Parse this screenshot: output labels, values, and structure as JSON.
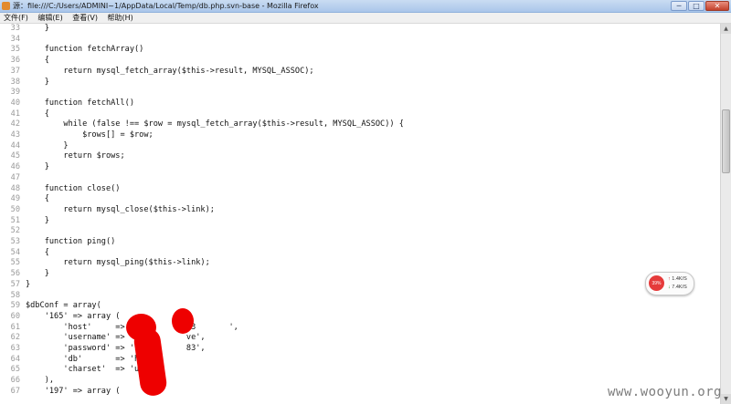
{
  "window": {
    "title": "源：file:///C:/Users/ADMINI~1/AppData/Local/Temp/db.php.svn-base - Mozilla Firefox",
    "buttons": {
      "minimize": "─",
      "maximize": "□",
      "close": "✕"
    }
  },
  "menu": {
    "items": [
      "文件(F)",
      "编辑(E)",
      "查看(V)",
      "帮助(H)"
    ]
  },
  "source": {
    "lines": [
      {
        "num": "33",
        "code": "    }"
      },
      {
        "num": "34",
        "code": ""
      },
      {
        "num": "35",
        "code": "    function fetchArray()"
      },
      {
        "num": "36",
        "code": "    {"
      },
      {
        "num": "37",
        "code": "        return mysql_fetch_array($this->result, MYSQL_ASSOC);"
      },
      {
        "num": "38",
        "code": "    }"
      },
      {
        "num": "39",
        "code": ""
      },
      {
        "num": "40",
        "code": "    function fetchAll()"
      },
      {
        "num": "41",
        "code": "    {"
      },
      {
        "num": "42",
        "code": "        while (false !== $row = mysql_fetch_array($this->result, MYSQL_ASSOC)) {"
      },
      {
        "num": "43",
        "code": "            $rows[] = $row;"
      },
      {
        "num": "44",
        "code": "        }"
      },
      {
        "num": "45",
        "code": "        return $rows;"
      },
      {
        "num": "46",
        "code": "    }"
      },
      {
        "num": "47",
        "code": ""
      },
      {
        "num": "48",
        "code": "    function close()"
      },
      {
        "num": "49",
        "code": "    {"
      },
      {
        "num": "50",
        "code": "        return mysql_close($this->link);"
      },
      {
        "num": "51",
        "code": "    }"
      },
      {
        "num": "52",
        "code": ""
      },
      {
        "num": "53",
        "code": "    function ping()"
      },
      {
        "num": "54",
        "code": "    {"
      },
      {
        "num": "55",
        "code": "        return mysql_ping($this->link);"
      },
      {
        "num": "56",
        "code": "    }"
      },
      {
        "num": "57",
        "code": "}"
      },
      {
        "num": "58",
        "code": ""
      },
      {
        "num": "59",
        "code": "$dbConf = array("
      },
      {
        "num": "60",
        "code": "    '165' => array ("
      },
      {
        "num": "61",
        "code": "        'host'     => '1         203       ',"
      },
      {
        "num": "62",
        "code": "        'username' => 'hj         ve',"
      },
      {
        "num": "63",
        "code": "        'password' => 'sl         83',"
      },
      {
        "num": "64",
        "code": "        'db'       => 'hj"
      },
      {
        "num": "65",
        "code": "        'charset'  => 'utf"
      },
      {
        "num": "66",
        "code": "    ),"
      },
      {
        "num": "67",
        "code": "    '197' => array ("
      }
    ]
  },
  "speed_widget": {
    "percent": "39%",
    "up": "1.4K/S",
    "down": "7.4K/S"
  },
  "watermark": "www.wooyun.org"
}
